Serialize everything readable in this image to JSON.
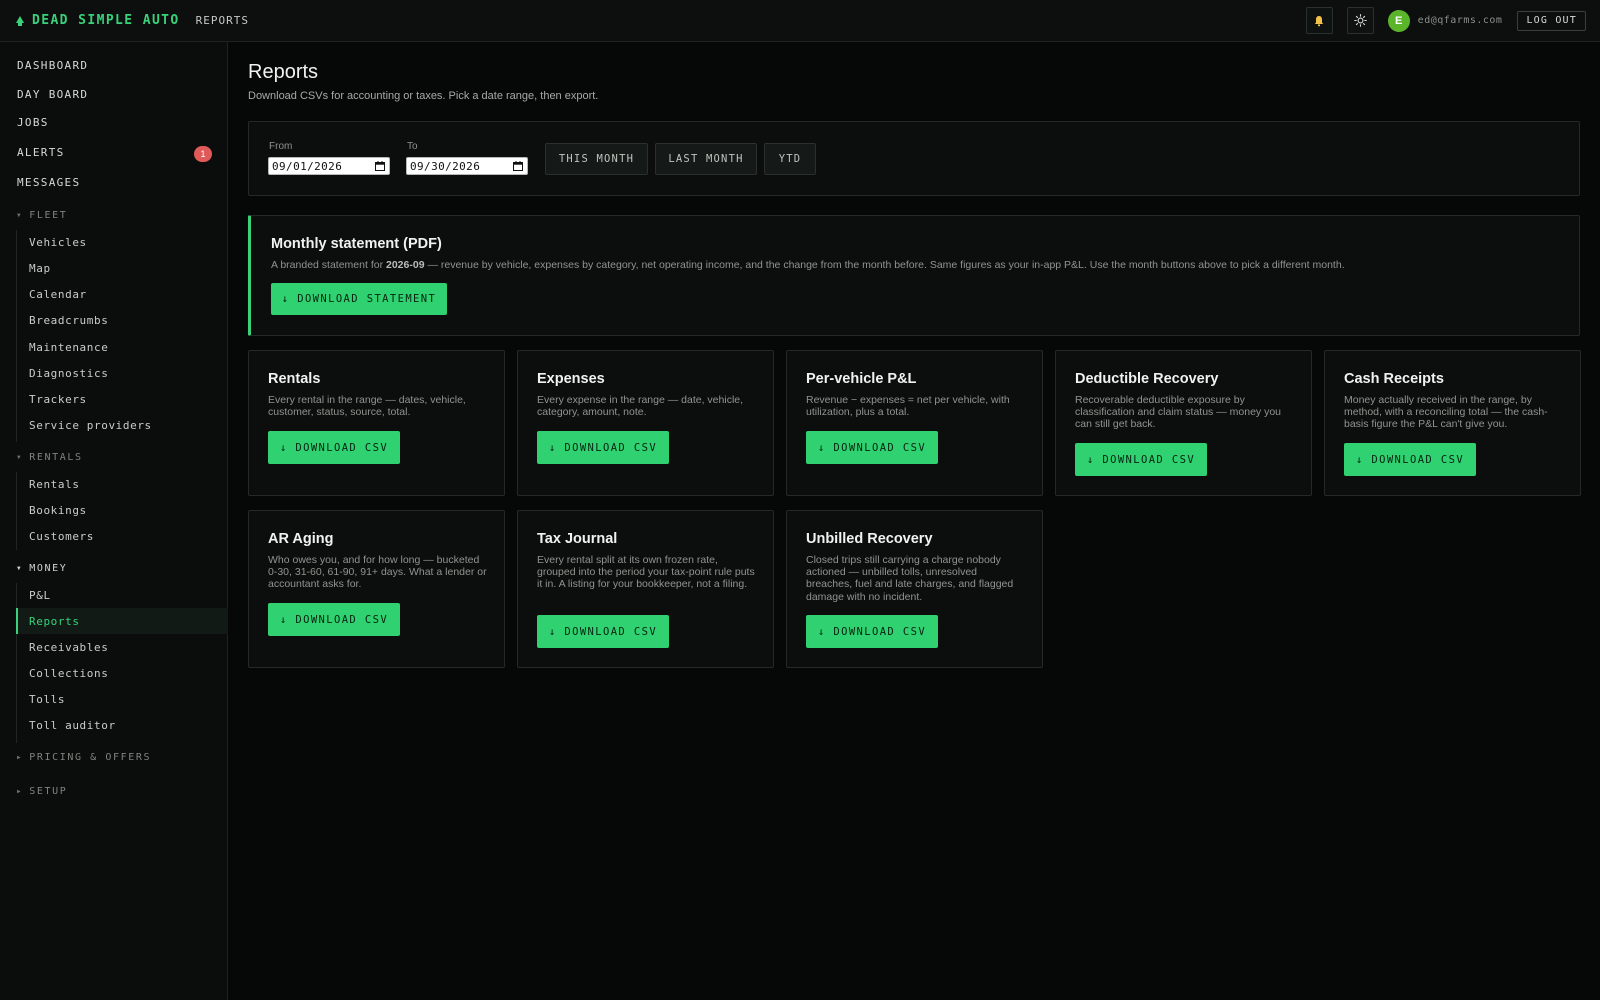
{
  "header": {
    "brand": "DEAD SIMPLE AUTO",
    "page": "REPORTS",
    "user_initial": "E",
    "email": "ed@qfarms.com",
    "logout_label": "LOG OUT",
    "icons": [
      "bell-icon",
      "sun-icon"
    ]
  },
  "sidebar": {
    "top_items": [
      {
        "label": "DASHBOARD"
      },
      {
        "label": "DAY BOARD"
      },
      {
        "label": "JOBS"
      },
      {
        "label": "ALERTS",
        "badge": "1"
      },
      {
        "label": "MESSAGES"
      }
    ],
    "groups": {
      "fleet": {
        "label": "FLEET",
        "items": [
          "Vehicles",
          "Map",
          "Calendar",
          "Breadcrumbs",
          "Maintenance",
          "Diagnostics",
          "Trackers",
          "Service providers"
        ]
      },
      "rentals": {
        "label": "RENTALS",
        "items": [
          "Rentals",
          "Bookings",
          "Customers"
        ]
      },
      "money": {
        "label": "MONEY",
        "items": [
          "P&L",
          "Reports",
          "Receivables",
          "Collections",
          "Tolls",
          "Toll auditor"
        ]
      },
      "pricing": {
        "label": "PRICING & OFFERS"
      },
      "setup": {
        "label": "SETUP"
      }
    },
    "active_item": "Reports"
  },
  "main": {
    "title": "Reports",
    "subtitle": "Download CSVs for accounting or taxes. Pick a date range, then export.",
    "filters": {
      "from_label": "From",
      "from_value": "09/01/2026",
      "to_label": "To",
      "to_value": "09/30/2026",
      "buttons": [
        "THIS MONTH",
        "LAST MONTH",
        "YTD"
      ]
    },
    "statement": {
      "title": "Monthly statement (PDF)",
      "desc_before": "A branded statement for ",
      "month": "2026-09",
      "desc_after": " — revenue by vehicle, expenses by category, net operating income, and the change from the month before. Same figures as your in-app P&L. Use the month buttons above to pick a different month.",
      "button": "↓ DOWNLOAD STATEMENT"
    },
    "cards": [
      {
        "title": "Rentals",
        "desc": "Every rental in the range — dates, vehicle, customer, status, source, total.",
        "button": "↓ DOWNLOAD CSV"
      },
      {
        "title": "Expenses",
        "desc": "Every expense in the range — date, vehicle, category, amount, note.",
        "button": "↓ DOWNLOAD CSV"
      },
      {
        "title": "Per-vehicle P&L",
        "desc": "Revenue − expenses = net per vehicle, with utilization, plus a total.",
        "button": "↓ DOWNLOAD CSV"
      },
      {
        "title": "Deductible Recovery",
        "desc": "Recoverable deductible exposure by classification and claim status — money you can still get back.",
        "button": "↓ DOWNLOAD CSV"
      },
      {
        "title": "Cash Receipts",
        "desc": "Money actually received in the range, by method, with a reconciling total — the cash-basis figure the P&L can't give you.",
        "button": "↓ DOWNLOAD CSV"
      },
      {
        "title": "AR Aging",
        "desc": "Who owes you, and for how long — bucketed 0-30, 31-60, 61-90, 91+ days. What a lender or accountant asks for.",
        "button": "↓ DOWNLOAD CSV"
      },
      {
        "title": "Tax Journal",
        "desc": "Every rental split at its own frozen rate, grouped into the period your tax-point rule puts it in. A listing for your bookkeeper, not a filing.",
        "button": "↓ DOWNLOAD CSV"
      },
      {
        "title": "Unbilled Recovery",
        "desc": "Closed trips still carrying a charge nobody actioned — unbilled tolls, unresolved breaches, fuel and late charges, and flagged damage with no incident.",
        "button": "↓ DOWNLOAD CSV"
      }
    ]
  },
  "colors": {
    "accent": "#39d17a",
    "button": "#2fd170",
    "badge": "#e05a5a",
    "avatar": "#5bb52b",
    "background": "#060807"
  }
}
